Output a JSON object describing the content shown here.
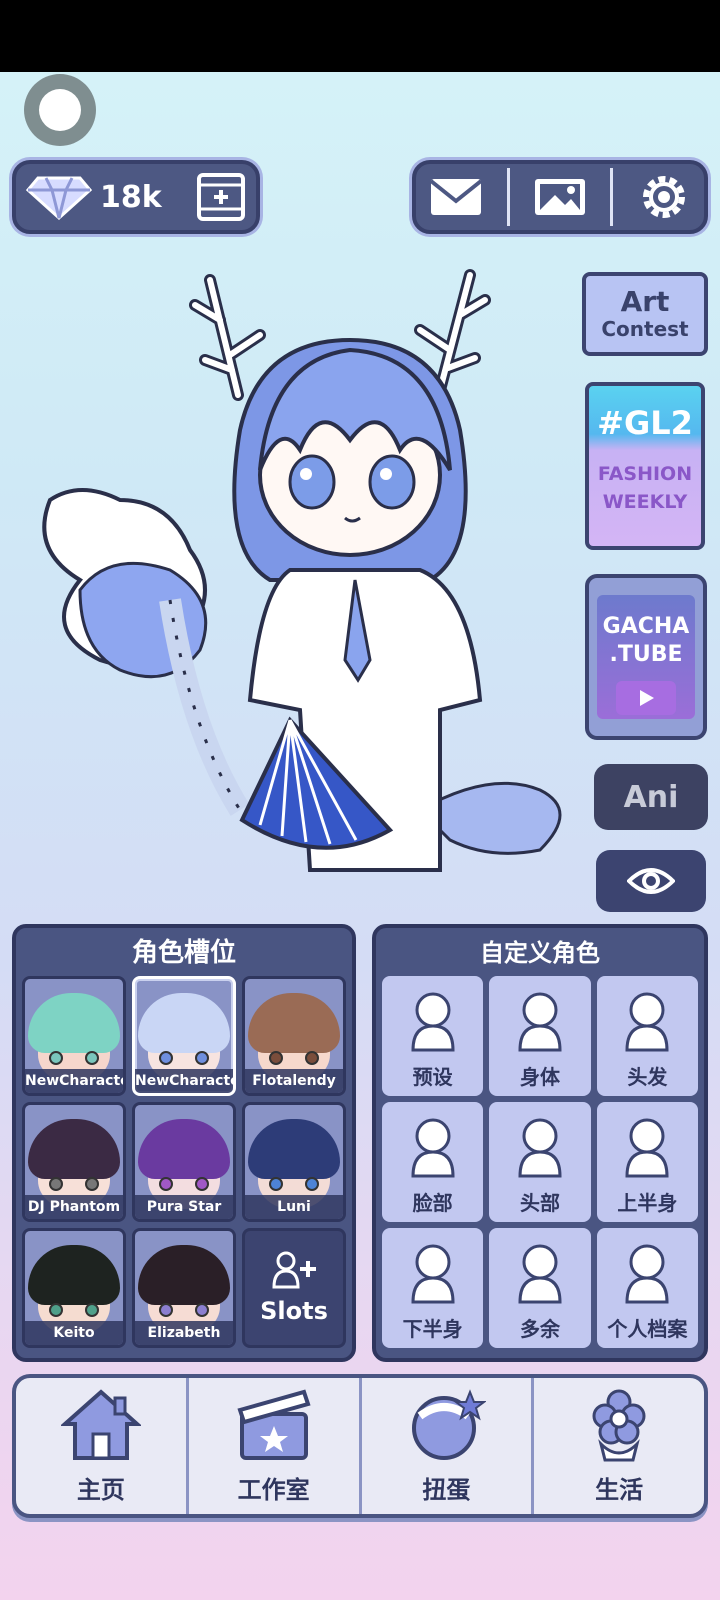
{
  "gems": {
    "count": "18k"
  },
  "side": {
    "art_contest": {
      "line1": "Art",
      "line2": "Contest"
    },
    "gl2": {
      "hashtag": "#GL2",
      "line1": "FASHION",
      "line2": "WEEKLY"
    },
    "gacha_tube": {
      "line1": "GACHA",
      "line2": ".TUBE"
    },
    "ani_label": "Ani"
  },
  "slots_panel": {
    "title": "角色槽位",
    "slots": [
      {
        "name": "NewCharacter",
        "hair": "#7ed3c4",
        "skin": "#f6d6cc",
        "eye": "#7ac6bc"
      },
      {
        "name": "NewCharacte",
        "hair": "#c9d6f5",
        "skin": "#f7e4e0",
        "eye": "#6f8fde"
      },
      {
        "name": "Flotalendy",
        "hair": "#9a6b55",
        "skin": "#f6d8cc",
        "eye": "#7a4d3b"
      },
      {
        "name": "DJ Phantom",
        "hair": "#3b2a44",
        "skin": "#f7e0d8",
        "eye": "#777"
      },
      {
        "name": "Pura Star",
        "hair": "#6a3aa0",
        "skin": "#f3dde0",
        "eye": "#a058c6"
      },
      {
        "name": "Luni",
        "hair": "#2d3c78",
        "skin": "#f3dcd6",
        "eye": "#4d83d6"
      },
      {
        "name": "Keito",
        "hair": "#1e2320",
        "skin": "#f5dcd0",
        "eye": "#4fa08a"
      },
      {
        "name": "Elizabeth",
        "hair": "#2a1f27",
        "skin": "#f6dcd4",
        "eye": "#8b7ed0"
      }
    ],
    "add_label": "Slots"
  },
  "custom_panel": {
    "title": "自定义角色",
    "categories": [
      "预设",
      "身体",
      "头发",
      "脸部",
      "头部",
      "上半身",
      "下半身",
      "多余",
      "个人档案"
    ]
  },
  "bottom_nav": [
    "主页",
    "工作室",
    "扭蛋",
    "生活"
  ]
}
